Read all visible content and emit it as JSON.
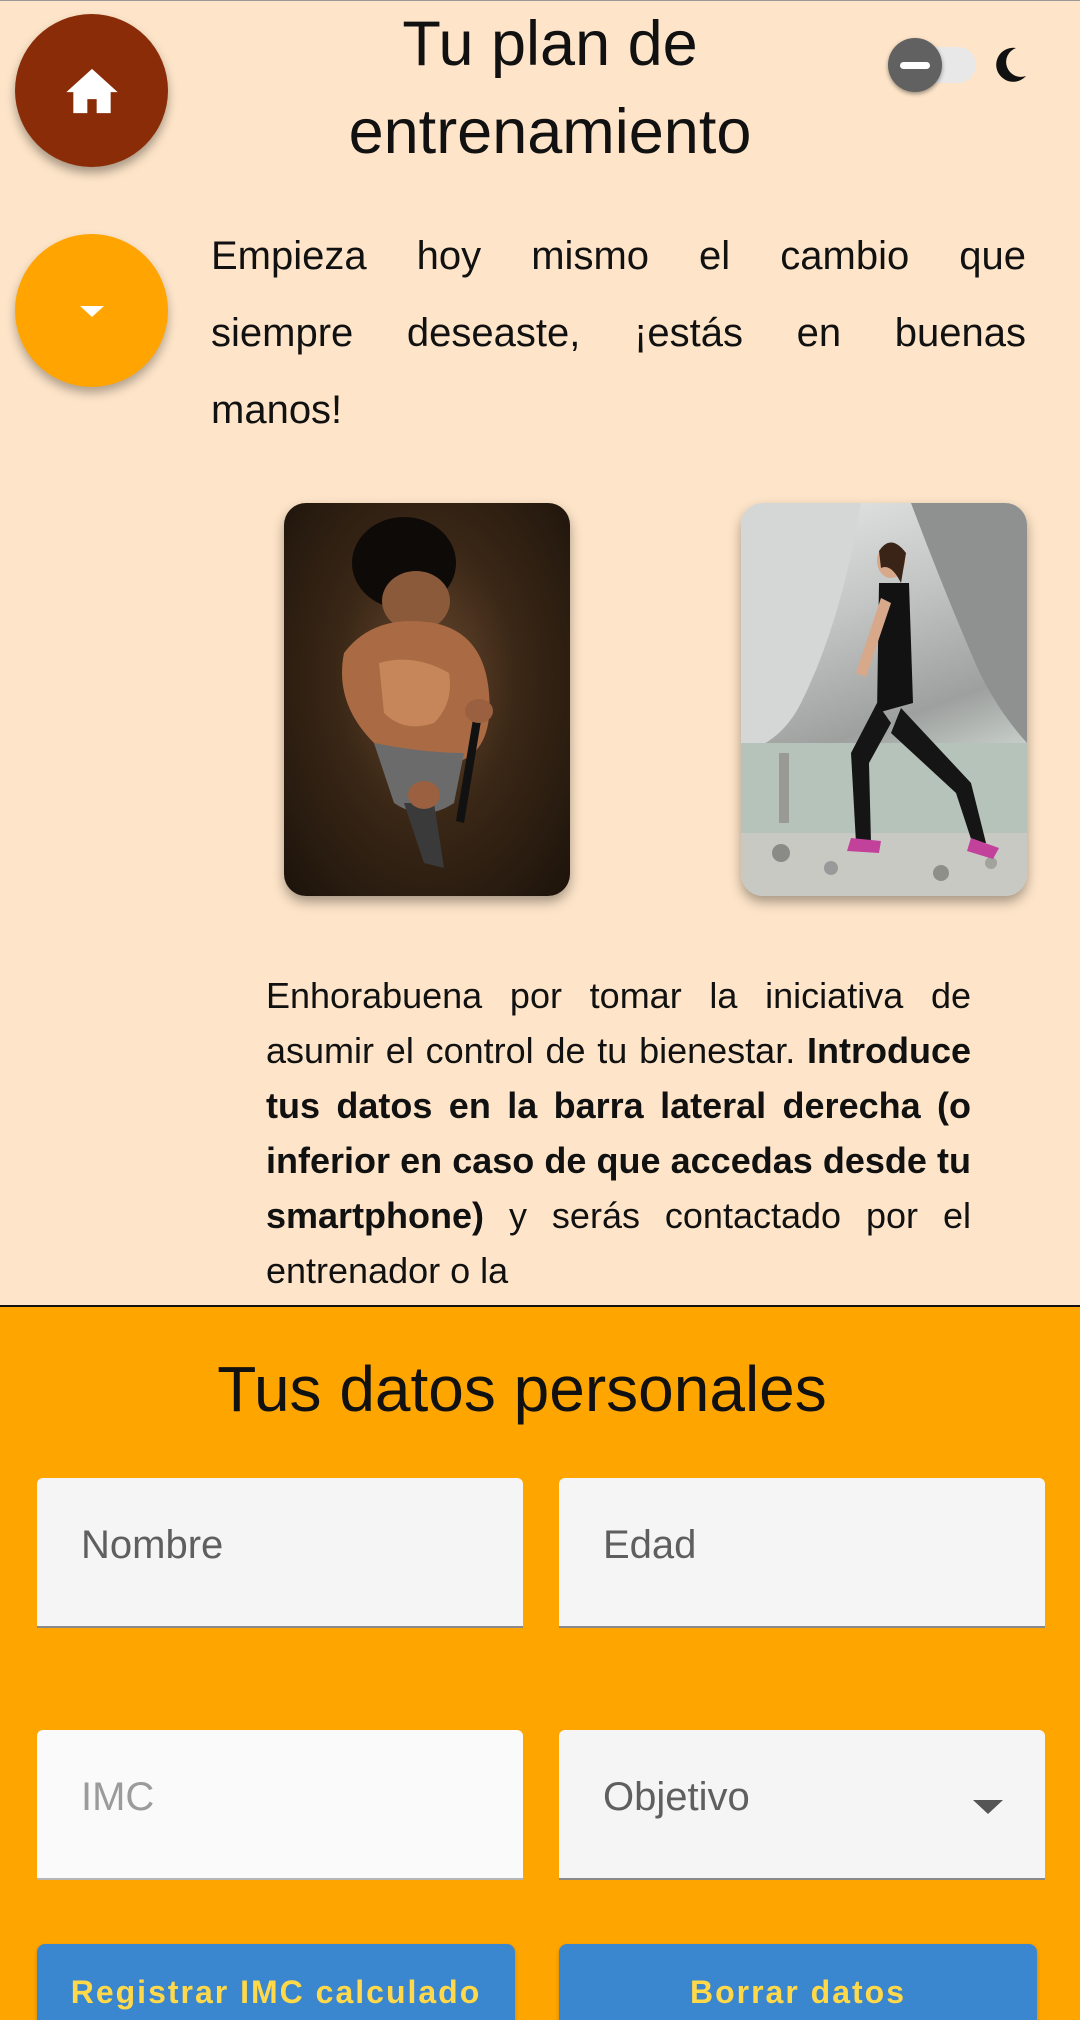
{
  "header": {
    "title": "Tu plan de entrenamiento",
    "home_icon": "home-icon",
    "expand_icon": "caret-down-icon",
    "theme_toggle_icon": "moon-icon"
  },
  "intro": {
    "text": "Empieza hoy mismo el cambio que siempre deseaste, ¡estás en buenas manos!"
  },
  "images": [
    {
      "name": "man-with-resistance-band-photo"
    },
    {
      "name": "woman-lunge-by-waterfall-photo"
    }
  ],
  "body": {
    "part1": "Enhorabuena por tomar la iniciativa de asumir el control de tu bienestar. ",
    "bold": "Introduce tus datos en la barra lateral derecha (o inferior en caso de que accedas desde tu smartphone)",
    "part2": " y serás contactado por el entrenador o la"
  },
  "form": {
    "title": "Tus datos personales",
    "fields": {
      "nombre": "Nombre",
      "edad": "Edad",
      "imc": "IMC",
      "objetivo": "Objetivo"
    },
    "buttons": {
      "registrar": "Registrar IMC calculado",
      "borrar": "Borrar datos"
    }
  },
  "colors": {
    "background": "#fee5c9",
    "home_button": "#8a2c07",
    "accent_orange": "#ffa500",
    "button_blue": "#3a86cf",
    "button_text": "#ffd94a"
  }
}
